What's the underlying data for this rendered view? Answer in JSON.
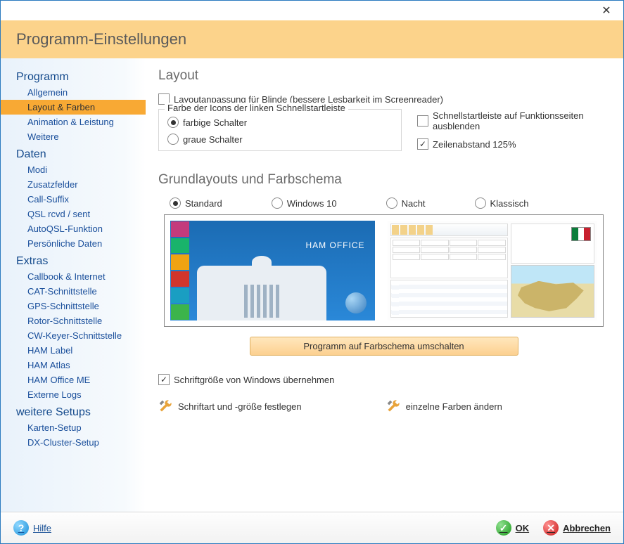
{
  "window": {
    "title": "Programm-Einstellungen"
  },
  "sidebar": {
    "groups": [
      {
        "title": "Programm",
        "items": [
          "Allgemein",
          "Layout & Farben",
          "Animation & Leistung",
          "Weitere"
        ],
        "selected": "Layout & Farben"
      },
      {
        "title": "Daten",
        "items": [
          "Modi",
          "Zusatzfelder",
          "Call-Suffix",
          "QSL rcvd / sent",
          "AutoQSL-Funktion",
          "Persönliche Daten"
        ]
      },
      {
        "title": "Extras",
        "items": [
          "Callbook & Internet",
          "CAT-Schnittstelle",
          "GPS-Schnittstelle",
          "Rotor-Schnittstelle",
          "CW-Keyer-Schnittstelle",
          "HAM Label",
          "HAM Atlas",
          "HAM Office ME",
          "Externe Logs"
        ]
      },
      {
        "title": "weitere Setups",
        "items": [
          "Karten-Setup",
          "DX-Cluster-Setup"
        ]
      }
    ]
  },
  "content": {
    "section_layout": {
      "title": "Layout",
      "blind_checkbox": "Layoutanpassung für Blinde (bessere Lesbarkeit im Screenreader)",
      "icon_group": {
        "legend": "Farbe der Icons der linken Schnellstartleiste",
        "opt_color": "farbige Schalter",
        "opt_gray": "graue Schalter",
        "selected": "farbige Schalter"
      },
      "right_checks": {
        "hide_quickbar": "Schnellstartleiste auf Funktionsseiten ausblenden",
        "line_spacing": "Zeilenabstand 125%"
      }
    },
    "section_scheme": {
      "title": "Grundlayouts und Farbschema",
      "options": [
        "Standard",
        "Windows 10",
        "Nacht",
        "Klassisch"
      ],
      "selected": "Standard",
      "preview_label": "HAM OFFICE",
      "switch_button": "Programm auf Farbschema umschalten"
    },
    "font_section": {
      "inherit_windows": "Schriftgröße von Windows übernehmen",
      "set_font": "Schriftart und -größe festlegen",
      "set_colors": "einzelne Farben ändern"
    }
  },
  "footer": {
    "help": "Hilfe",
    "ok": "OK",
    "cancel": "Abbrechen"
  }
}
